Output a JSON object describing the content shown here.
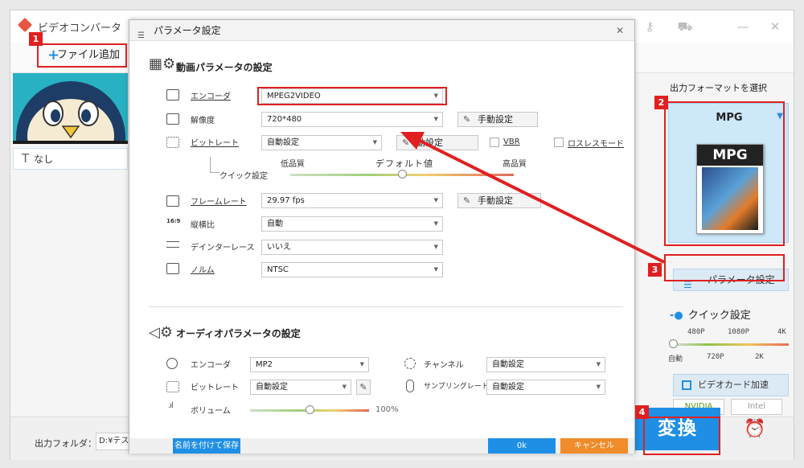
{
  "app": {
    "title": "ビデオコンバータ",
    "add_file_label": "ファイル追加",
    "subtitle_option": "なし",
    "output_folder_label": "出力フォルダ：",
    "output_folder_value": "D:¥テスト",
    "convert_label": "変換"
  },
  "right_panel": {
    "format_heading": "出力フォーマットを選択",
    "format_name": "MPG",
    "format_image_label": "MPG",
    "param_button_label": "パラメータ設定",
    "quick_settings_title": "クイック設定",
    "quick_top_labels": [
      "480P",
      "1080P",
      "4K"
    ],
    "quick_bottom_labels": [
      "自動",
      "720P",
      "2K"
    ],
    "gpu_label": "ビデオカード加速",
    "vendors": [
      "NVIDIA",
      "Intel"
    ]
  },
  "dialog": {
    "title": "パラメータ設定",
    "video_section_title": "動画パラメータの設定",
    "video": {
      "encoder_label": "エンコーダ",
      "encoder_value": "MPEG2VIDEO",
      "resolution_label": "解像度",
      "resolution_value": "720*480",
      "manual_label": "手動設定",
      "bitrate_label": "ビットレート",
      "bitrate_value": "自動設定",
      "bitrate_manual_label": "動設定",
      "vbr_label": "VBR",
      "lossless_label": "ロスレスモード",
      "quick_label": "クイック設定",
      "quality_low": "低品質",
      "quality_default": "デフォルト値",
      "quality_high": "高品質",
      "quality_level": 0.5,
      "framerate_label": "フレームレート",
      "framerate_value": "29.97 fps",
      "aspect_icon_text": "16:9",
      "aspect_label": "縦横比",
      "aspect_value": "自動",
      "deinterlace_label": "デインターレース",
      "deinterlace_value": "いいえ",
      "norm_label": "ノルム",
      "norm_value": "NTSC"
    },
    "audio_section_title": "オーディオパラメータの設定",
    "audio": {
      "encoder_label": "エンコーダ",
      "encoder_value": "MP2",
      "bitrate_label": "ビットレート",
      "bitrate_value": "自動設定",
      "channel_label": "チャンネル",
      "channel_value": "自動設定",
      "samplerate_label": "サンプリングレート",
      "samplerate_value": "自動設定",
      "volume_label": "ボリューム",
      "volume_value": "100%",
      "volume_level": 0.5
    },
    "save_as_label": "名前を付けて保存",
    "ok_label": "0k",
    "cancel_label": "キャンセル"
  },
  "annotations": {
    "badges": [
      "1",
      "2",
      "3",
      "4"
    ],
    "highlight_color": "#e02020",
    "accent_color": "#1f8fe6"
  }
}
